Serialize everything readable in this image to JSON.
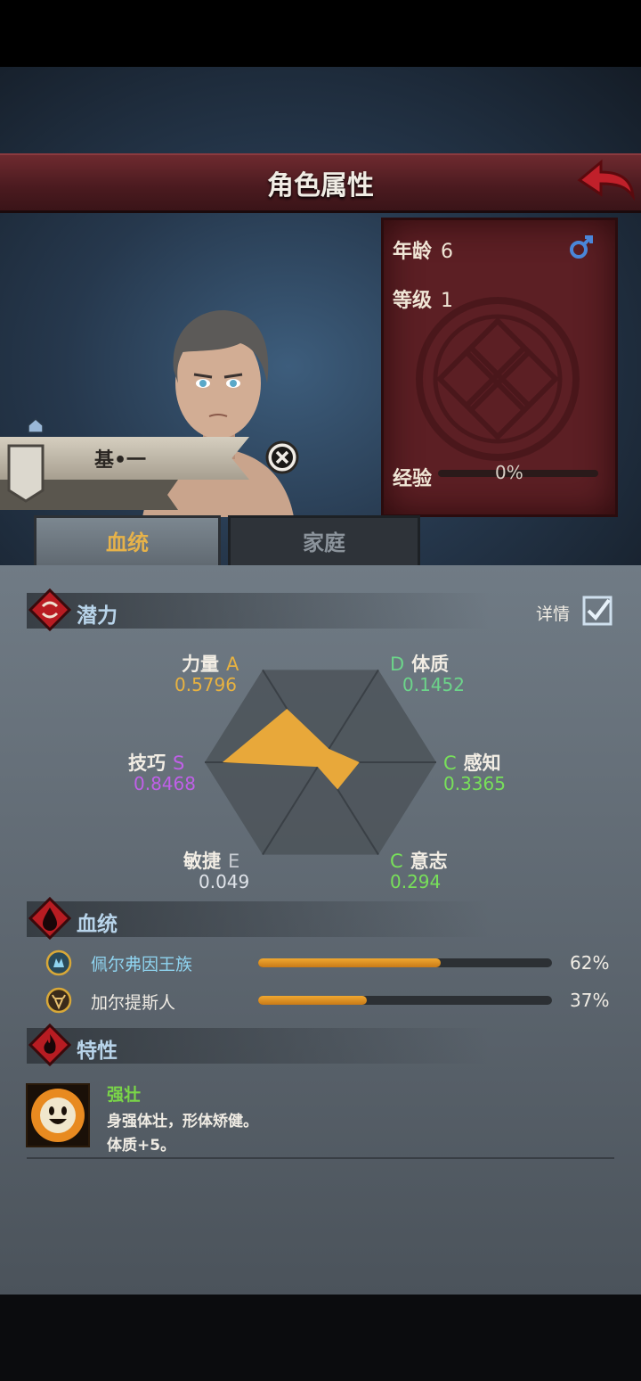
{
  "header": {
    "title": "角色属性"
  },
  "character": {
    "name": "基•一"
  },
  "info": {
    "age_label": "年龄",
    "age": "6",
    "level_label": "等级",
    "level": "1",
    "exp_label": "经验",
    "exp_percent": "0%",
    "exp_fraction": 0.0
  },
  "tabs": [
    {
      "label": "血统",
      "active": true
    },
    {
      "label": "家庭",
      "active": false
    }
  ],
  "potential": {
    "title": "潜力",
    "detail_label": "详情",
    "detail_checked": true,
    "stats": [
      {
        "name": "力量",
        "grade": "A",
        "value": "0.5796",
        "color": "#e8b240"
      },
      {
        "name": "体质",
        "grade": "D",
        "value": "0.1452",
        "color": "#6cd48a"
      },
      {
        "name": "感知",
        "grade": "C",
        "value": "0.3365",
        "color": "#78e05a"
      },
      {
        "name": "意志",
        "grade": "C",
        "value": "0.294",
        "color": "#78e05a"
      },
      {
        "name": "敏捷",
        "grade": "E",
        "value": "0.049",
        "color": "#c8ccd2"
      },
      {
        "name": "技巧",
        "grade": "S",
        "value": "0.8468",
        "color": "#c060e8"
      }
    ]
  },
  "bloodline": {
    "title": "血统",
    "items": [
      {
        "name": "佩尔弗因王族",
        "percent": "62%",
        "fraction": 0.62,
        "color": "#8fd4f0"
      },
      {
        "name": "加尔提斯人",
        "percent": "37%",
        "fraction": 0.37,
        "color": "#f0ece4"
      }
    ]
  },
  "traits": {
    "title": "特性",
    "items": [
      {
        "name": "强壮",
        "desc1": "身强体壮，形体矫健。",
        "desc2": "体质+5。"
      }
    ]
  }
}
